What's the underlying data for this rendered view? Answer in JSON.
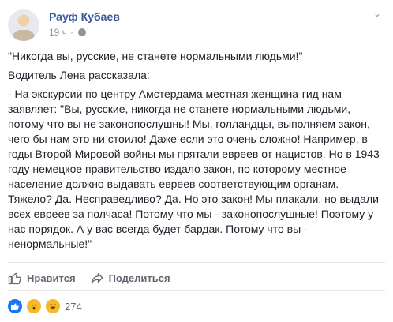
{
  "post": {
    "author": "Рауф Кубаев",
    "time": "19 ч",
    "separator": "·",
    "text_quote": "\"Никогда вы, русские, не станете нормальными людьми!\"",
    "text_intro": "Водитель Лена рассказала:",
    "text_body": "- На экскурсии по центру Амстердама местная женщина-гид нам\nзаявляет: \"Вы, русские, никогда не станете нормальными людьми,\nпотому что вы не законопослушны! Мы, голландцы, выполняем закон,\nчего бы нам это ни стоило! Даже если это очень сложно! Например, в\nгоды Второй Мировой войны мы прятали евреев от нацистов. Но в 1943\nгоду немецкое правительство издало закон, по которому местное\nнаселение должно выдавать евреев соответствующим органам.\nТяжело? Да. Несправедливо? Да. Но это закон! Мы плакали, но выдали\nвсех евреев за полчаса! Потому что мы - законопослушные! Поэтому у\nнас порядок. А у вас всегда будет бардак. Потому что вы -\nненормальные!\""
  },
  "actions": {
    "like_label": "Нравится",
    "share_label": "Поделиться"
  },
  "reactions": {
    "count": "274",
    "icons": [
      "like-icon",
      "wow-icon",
      "haha-icon"
    ]
  },
  "colors": {
    "author": "#365899",
    "meta": "#90949c",
    "body": "#1d2129",
    "like_blue": "#1877f2",
    "emoji_yellow": "#f7b928"
  }
}
